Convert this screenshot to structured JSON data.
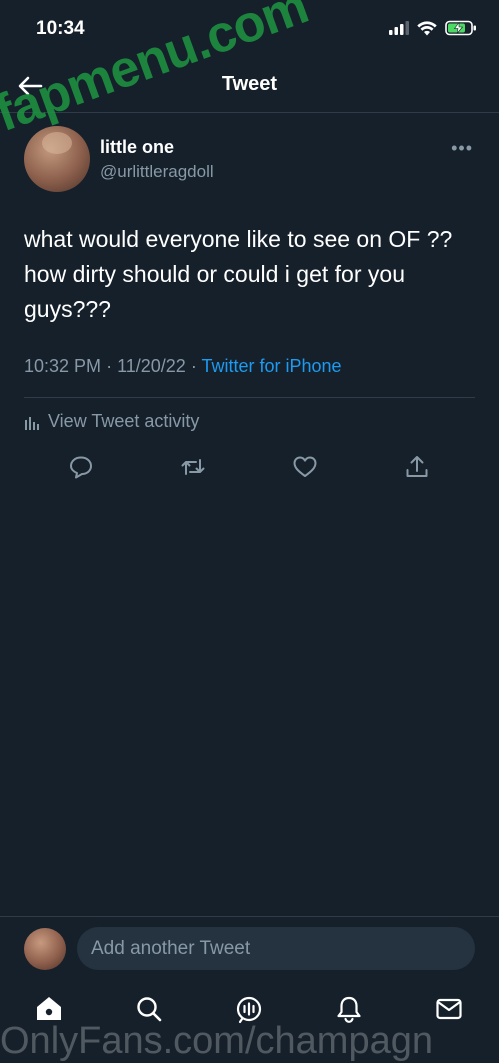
{
  "status_bar": {
    "time": "10:34"
  },
  "header": {
    "title": "Tweet"
  },
  "tweet": {
    "display_name": "little one",
    "handle": "@urlittleragdoll",
    "text": "what would everyone like to see on OF ?? how dirty should or could i get for you guys???",
    "time": "10:32 PM",
    "date": "11/20/22",
    "client": "Twitter for iPhone",
    "activity_label": "View Tweet activity",
    "more_label": "•••"
  },
  "actions": {
    "icons": [
      "reply-icon",
      "retweet-icon",
      "like-icon",
      "share-icon"
    ]
  },
  "reply": {
    "placeholder": "Add another Tweet"
  },
  "tabbar": {
    "icons": [
      "home-icon",
      "search-icon",
      "spaces-icon",
      "notifications-icon",
      "messages-icon"
    ]
  },
  "watermarks": {
    "overlay": "fapmenu.com",
    "footer": "OnlyFans.com/champagn"
  },
  "colors": {
    "background": "#15202b",
    "accent": "#1d9bf0",
    "muted": "#8899a6",
    "watermark": "#1f9a43"
  }
}
